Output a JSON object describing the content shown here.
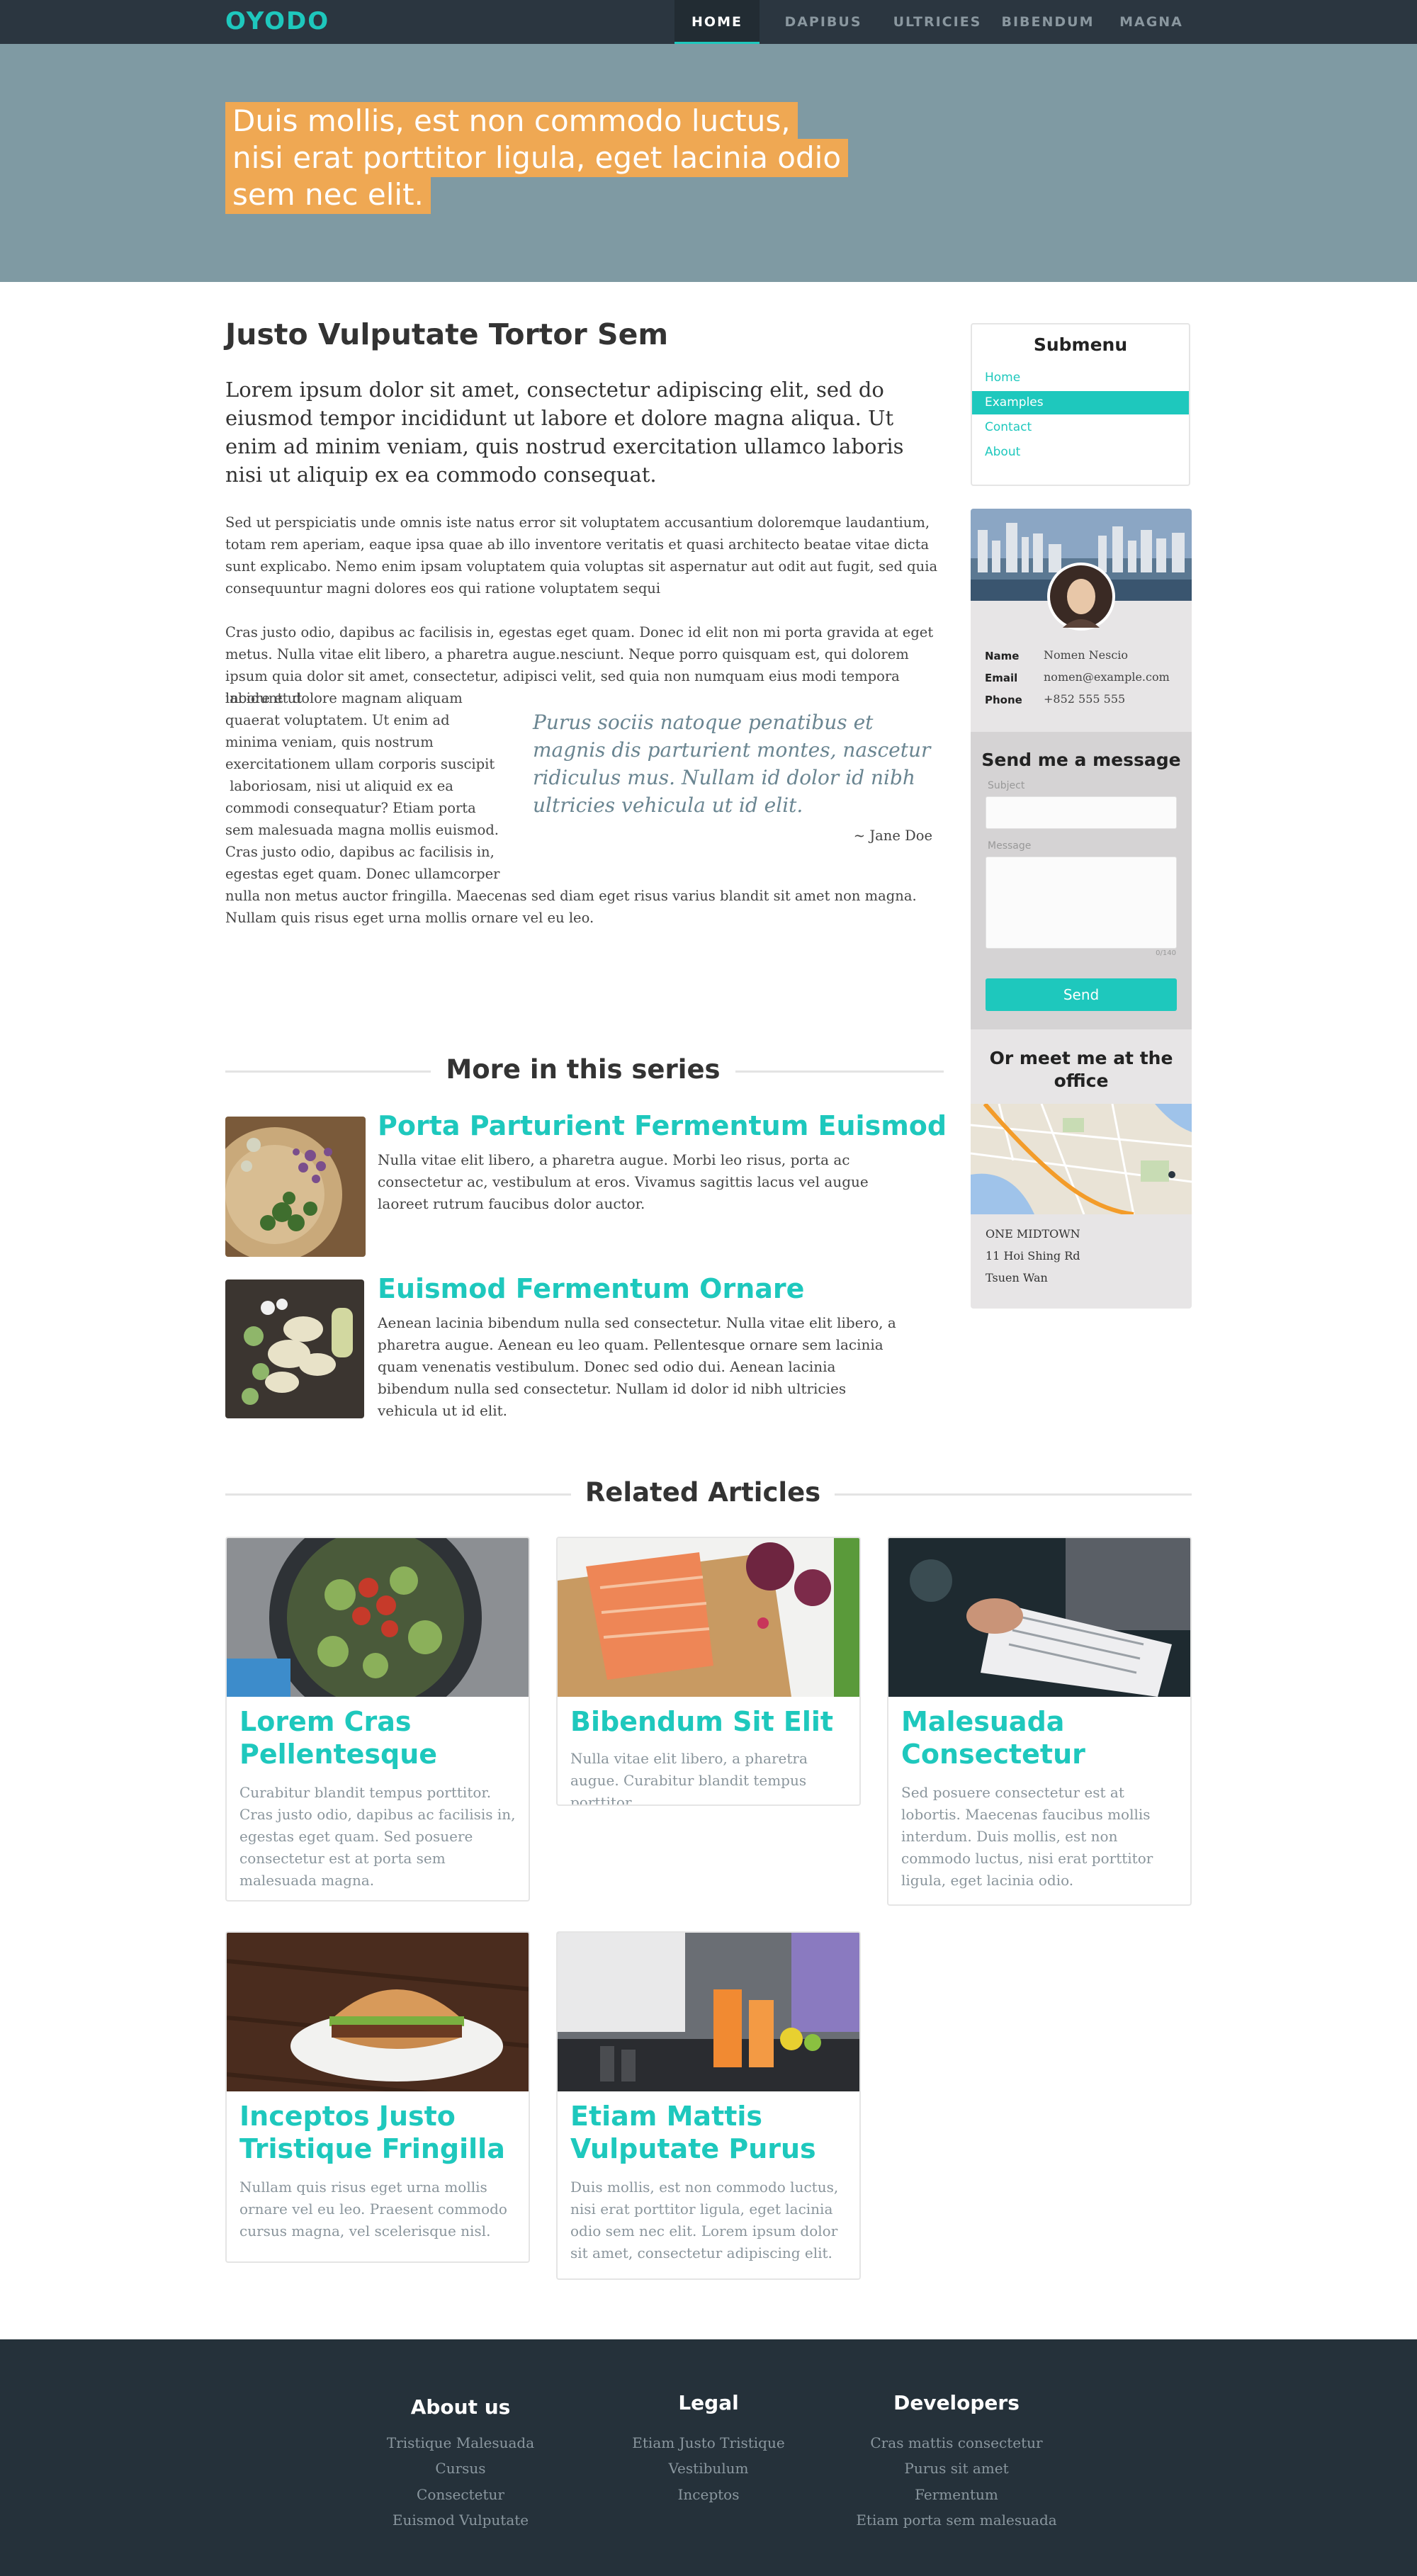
{
  "nav": {
    "logo": "OYODO",
    "items": [
      "HOME",
      "DAPIBUS",
      "ULTRICIES",
      "BIBENDUM",
      "MAGNA"
    ],
    "active": "HOME"
  },
  "hero": {
    "lines": [
      "Duis mollis, est non commodo luctus,",
      "nisi erat porttitor ligula, eget lacinia odio",
      "sem nec elit."
    ]
  },
  "article": {
    "title": "Justo Vulputate Tortor Sem",
    "lead": "Lorem ipsum dolor sit amet, consectetur adipiscing elit, sed do eiusmod tempor incididunt ut labore et dolore magna aliqua. Ut enim ad minim veniam, quis nostrud exercitation ullamco laboris nisi ut aliquip ex ea commodo consequat.",
    "para1": "Sed ut perspiciatis unde omnis iste natus error sit voluptatem accusantium doloremque laudantium, totam rem aperiam, eaque ipsa quae ab illo inventore veritatis et quasi architecto beatae vitae dicta sunt explicabo. Nemo enim ipsam voluptatem quia voluptas sit aspernatur aut odit aut fugit, sed quia consequuntur magni dolores eos qui ratione voluptatem sequi",
    "para2_top": "Cras justo odio, dapibus ac facilisis in, egestas eget quam. Donec id elit non mi porta gravida at eget metus. Nulla vitae elit libero, a pharetra augue.nesciunt. Neque porro quisquam est, qui dolorem ipsum quia dolor sit amet, consectetur, adipisci velit, sed quia non numquam eius modi tempora incidunt ut",
    "para2_col": [
      "labore et dolore magnam aliquam",
      "quaerat voluptatem. Ut enim ad",
      "minima veniam, quis nostrum",
      "exercitationem ullam corporis suscipit",
      " laboriosam, nisi ut aliquid ex ea",
      "commodi consequatur? Etiam porta",
      "sem malesuada magna mollis euismod.",
      "Cras justo odio, dapibus ac facilisis in,",
      "egestas eget quam. Donec ullamcorper"
    ],
    "para2_bottom": "nulla non metus auctor fringilla. Maecenas sed diam eget risus varius blandit sit amet non magna. Nullam quis risus eget urna mollis ornare vel eu leo.",
    "quote": "Purus sociis natoque penatibus et magnis dis parturient montes, nascetur ridiculus mus. Nullam id dolor id nibh ultricies vehicula ut id elit.",
    "cite": "~ Jane Doe"
  },
  "series": {
    "heading": "More in this series",
    "items": [
      {
        "title": "Porta Parturient Fermentum Euismod",
        "text": "Nulla vitae elit libero, a pharetra augue. Morbi leo risus, porta ac consectetur ac, vestibulum at eros. Vivamus sagittis lacus vel augue laoreet rutrum faucibus dolor auctor."
      },
      {
        "title": "Euismod Fermentum Ornare",
        "text": "Aenean lacinia bibendum nulla sed consectetur. Nulla vitae elit libero, a pharetra augue. Aenean eu leo quam. Pellentesque ornare sem lacinia quam venenatis vestibulum. Donec sed odio dui. Aenean lacinia bibendum nulla sed consectetur. Nullam id dolor id nibh ultricies vehicula ut id elit."
      }
    ]
  },
  "sidebar": {
    "submenu_title": "Submenu",
    "submenu": [
      "Home",
      "Examples",
      "Contact",
      "About"
    ],
    "submenu_active": "Examples",
    "profile": {
      "name_label": "Name",
      "name": "Nomen Nescio",
      "email_label": "Email",
      "email": "nomen@example.com",
      "phone_label": "Phone",
      "phone": "+852 555 555"
    },
    "message": {
      "title": "Send me a message",
      "subject_label": "Subject",
      "message_label": "Message",
      "char_count": "0/140",
      "send_label": "Send"
    },
    "office": {
      "title_line1": "Or meet me at the",
      "title_line2": "office",
      "address": [
        "ONE MIDTOWN",
        "11 Hoi Shing Rd",
        "Tsuen Wan"
      ]
    }
  },
  "related": {
    "heading": "Related Articles",
    "cards": [
      {
        "title": "Lorem Cras Pellentesque",
        "text": "Curabitur blandit tempus porttitor. Cras justo odio, dapibus ac facilisis in, egestas eget quam. Sed posuere consectetur est at porta sem malesuada magna."
      },
      {
        "title": "Bibendum Sit Elit",
        "text": "Nulla vitae elit libero, a pharetra augue. Curabitur blandit tempus porttitor."
      },
      {
        "title": "Malesuada Consectetur",
        "text": "Sed posuere consectetur est at lobortis. Maecenas faucibus mollis interdum. Duis mollis, est non commodo luctus, nisi erat porttitor ligula, eget lacinia odio."
      },
      {
        "title": "Inceptos Justo Tristique Fringilla",
        "text": "Nullam quis risus eget urna mollis ornare vel eu leo. Praesent commodo cursus magna, vel scelerisque nisl."
      },
      {
        "title": "Etiam Mattis Vulputate Purus",
        "text": "Duis mollis, est non commodo luctus, nisi erat porttitor ligula, eget lacinia odio sem nec elit. Lorem ipsum dolor sit amet, consectetur adipiscing elit."
      }
    ]
  },
  "footer": {
    "columns": [
      {
        "title": "About us",
        "links": [
          "Tristique Malesuada",
          "Cursus",
          "Consectetur",
          "Euismod Vulputate"
        ]
      },
      {
        "title": "Legal",
        "links": [
          "Etiam Justo Tristique",
          "Vestibulum",
          "Inceptos"
        ]
      },
      {
        "title": "Developers",
        "links": [
          "Cras mattis consectetur",
          "Purus sit amet",
          "Fermentum",
          "Etiam porta sem malesuada"
        ]
      }
    ]
  },
  "colors": {
    "accent": "#1ec8bd",
    "nav_bg": "#2b3640",
    "hero_bg": "#7f9aa3",
    "hero_highlight": "#efa853",
    "footer_bg": "#25313a"
  }
}
